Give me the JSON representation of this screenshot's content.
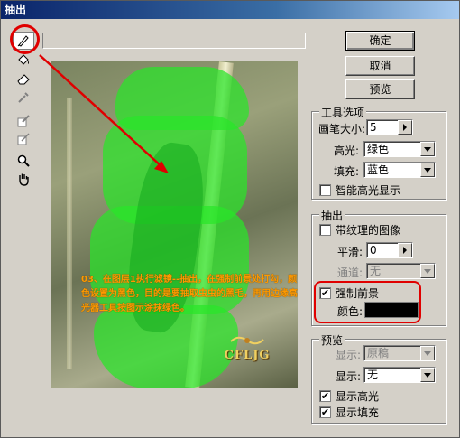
{
  "window": {
    "title": "抽出"
  },
  "tools": [
    {
      "name": "edge-highlighter-tool",
      "icon": "marker-icon",
      "active": true
    },
    {
      "name": "fill-tool",
      "icon": "paint-bucket-icon",
      "active": false
    },
    {
      "name": "eraser-tool",
      "icon": "eraser-icon",
      "active": false
    },
    {
      "name": "eyedropper-tool",
      "icon": "eyedropper-icon",
      "active": false
    },
    {
      "name": "cleanup-tool",
      "icon": "cleanup-icon",
      "active": false
    },
    {
      "name": "edge-touchup-tool",
      "icon": "edge-touchup-icon",
      "active": false
    },
    {
      "name": "zoom-tool",
      "icon": "magnifier-icon",
      "active": false
    },
    {
      "name": "hand-tool",
      "icon": "hand-icon",
      "active": false
    }
  ],
  "buttons": {
    "ok": "确定",
    "cancel": "取消",
    "preview": "预览"
  },
  "tool_options": {
    "title": "工具选项",
    "brush_size_label": "画笔大小:",
    "brush_size_value": "5",
    "highlight_label": "高光:",
    "highlight_value": "绿色",
    "fill_label": "填充:",
    "fill_value": "蓝色",
    "smart_highlight_label": "智能高光显示",
    "smart_highlight_checked": false
  },
  "extraction": {
    "title": "抽出",
    "textured_label": "带纹理的图像",
    "textured_checked": false,
    "smooth_label": "平滑:",
    "smooth_value": "0",
    "channel_label": "通道:",
    "channel_value": "无",
    "force_fg_label": "强制前景",
    "force_fg_checked": true,
    "color_label": "颜色:",
    "color_value": "#000000"
  },
  "preview_group": {
    "title": "预览",
    "show_label_1": "显示:",
    "show_value_1": "原稿",
    "show_label_2": "显示:",
    "show_value_2": "无",
    "show_highlight_label": "显示高光",
    "show_highlight_checked": true,
    "show_fill_label": "显示填充",
    "show_fill_checked": true
  },
  "canvas": {
    "caption": "03、在图层1执行滤镜--抽出，在强制前景处打勾，颜色设置为黑色，目的是要抽取虫虫的黑毛，再用边缘高光器工具按图示涂抹绿色。",
    "logo_text": "CFLJG"
  },
  "colors": {
    "annotation_red": "#e00000",
    "highlight_green": "#28e628",
    "caption_orange": "#ff9900"
  }
}
